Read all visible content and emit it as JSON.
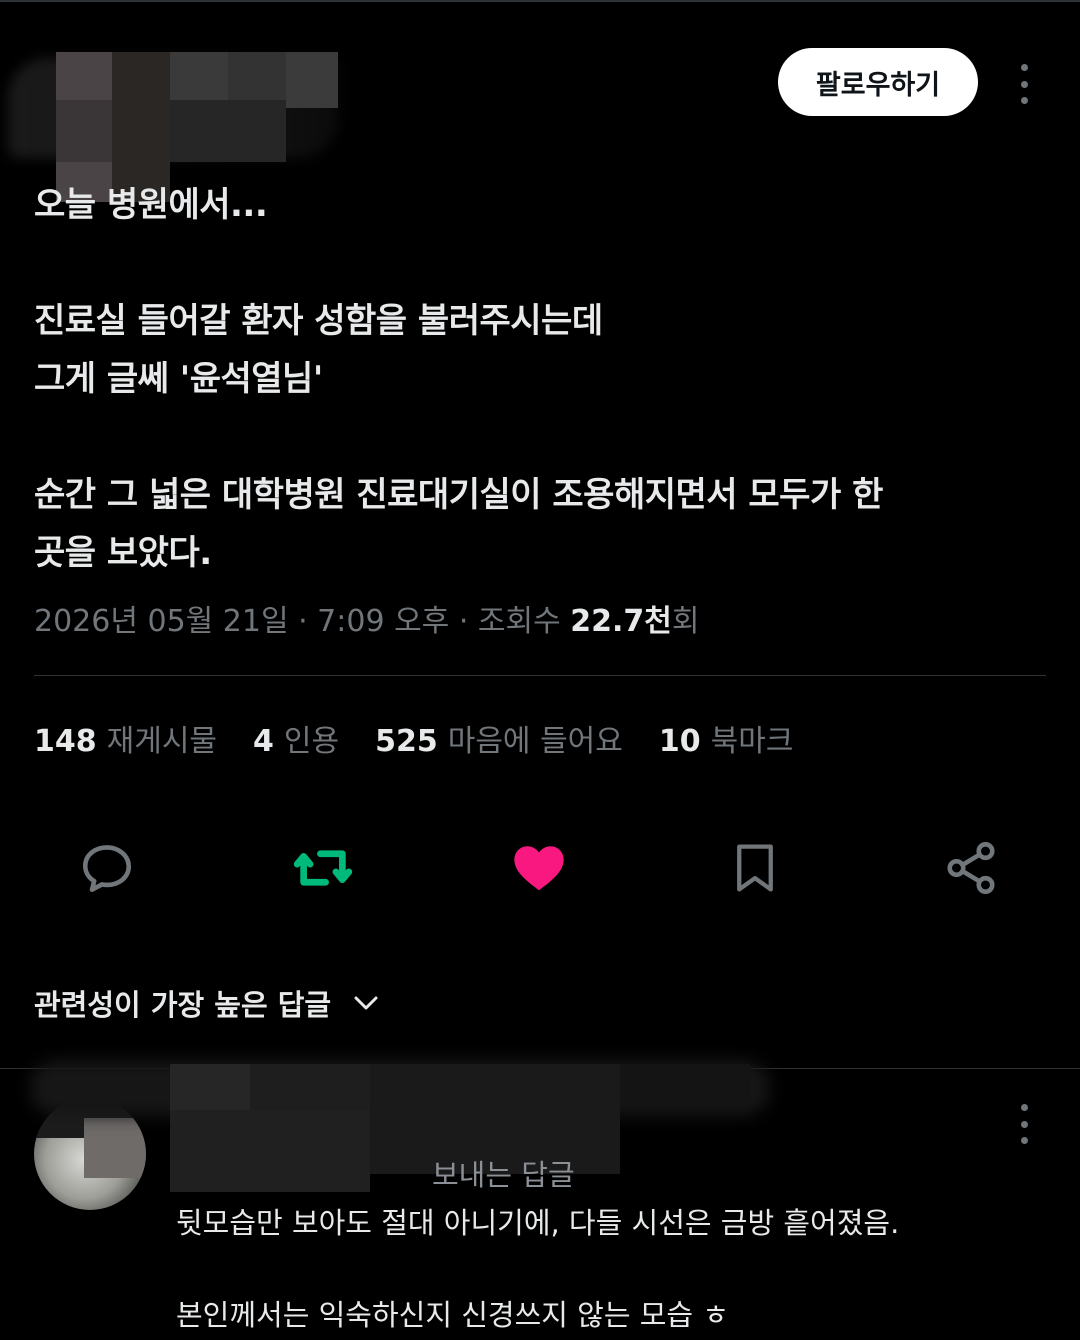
{
  "post": {
    "follow_label": "팔로우하기",
    "lines": [
      "오늘 병원에서...",
      "진료실 들어갈 환자 성함을 불러주시는데",
      "그게 글쎄 '윤석열님'",
      "순간 그 넓은 대학병원 진료대기실이 조용해지면서 모두가 한",
      "곳을 보았다."
    ],
    "meta_prefix": "2026년 05월 21일 · 7:09 오후 · 조회수 ",
    "views": "22.7천",
    "views_suffix": "회"
  },
  "stats": [
    {
      "num": "148",
      "label": "재게시물"
    },
    {
      "num": "4",
      "label": "인용"
    },
    {
      "num": "525",
      "label": "마음에 들어요"
    },
    {
      "num": "10",
      "label": "북마크"
    }
  ],
  "actions": {
    "reply_icon": "comment-icon",
    "repost_icon": "repost-icon",
    "like_icon": "heart-icon",
    "bookmark_icon": "bookmark-icon",
    "share_icon": "share-icon",
    "colors": {
      "repost": "#00ba7c",
      "like": "#f91880",
      "default": "#71767b"
    }
  },
  "sort": {
    "label": "관련성이 가장 높은 답글"
  },
  "reply": {
    "label_partial": "보내는 답글",
    "line1": "뒷모습만 보아도 절대 아니기에, 다들 시선은 금방 흩어졌음.",
    "line2": "본인께서는 익숙하신지 신경쓰지 않는 모습 ㅎ"
  }
}
